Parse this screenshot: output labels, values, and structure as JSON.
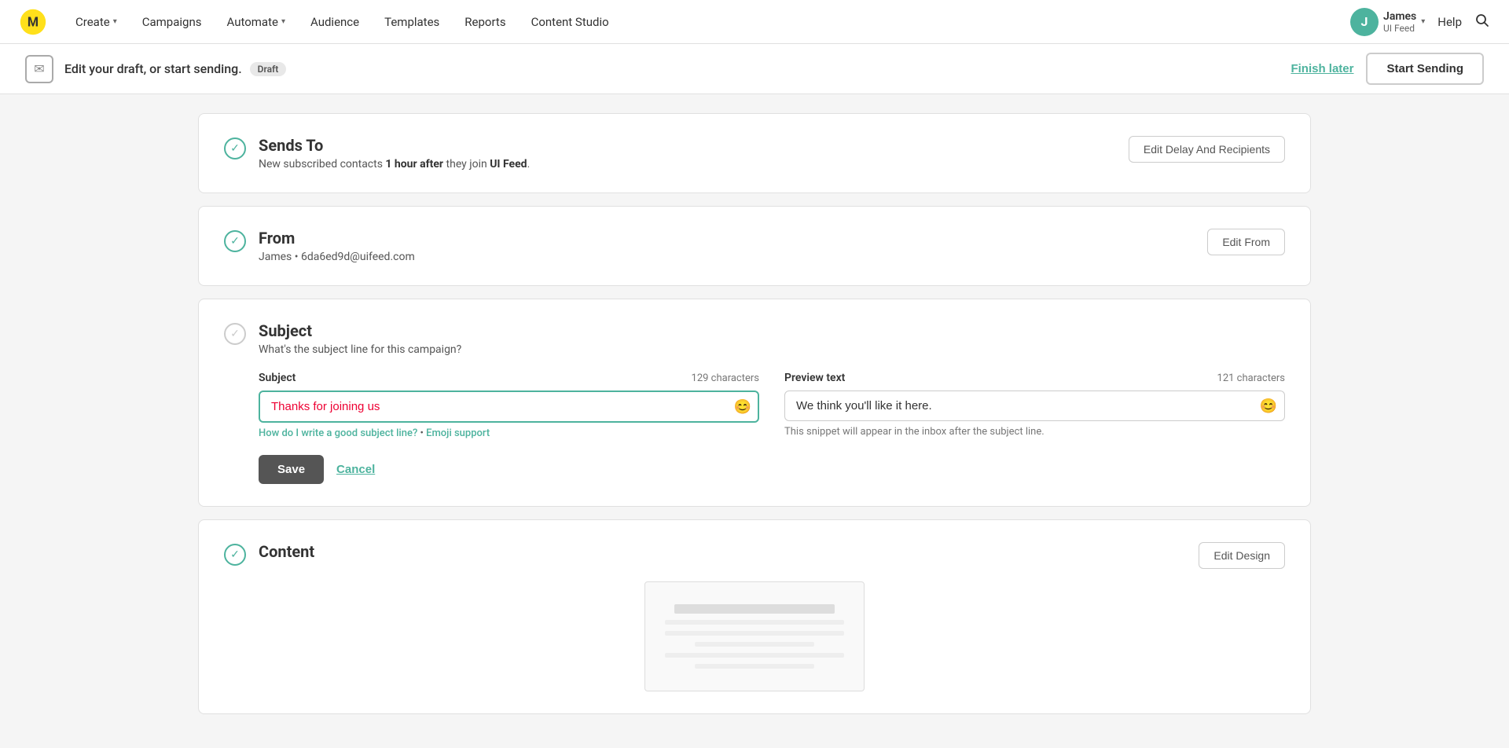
{
  "nav": {
    "logo_alt": "Mailchimp",
    "items": [
      {
        "label": "Create",
        "has_dropdown": true
      },
      {
        "label": "Campaigns",
        "has_dropdown": false
      },
      {
        "label": "Automate",
        "has_dropdown": true
      },
      {
        "label": "Audience",
        "has_dropdown": false
      },
      {
        "label": "Templates",
        "has_dropdown": false
      },
      {
        "label": "Reports",
        "has_dropdown": false
      },
      {
        "label": "Content Studio",
        "has_dropdown": false
      }
    ],
    "user": {
      "initial": "J",
      "name": "James",
      "account": "UI Feed"
    },
    "help_label": "Help"
  },
  "top_bar": {
    "icon": "✉",
    "text": "Edit your draft, or start sending.",
    "badge": "Draft",
    "finish_later_label": "Finish later",
    "start_sending_label": "Start Sending"
  },
  "sends_to": {
    "title": "Sends To",
    "description_prefix": "New subscribed contacts ",
    "description_bold": "1 hour after",
    "description_suffix": " they join ",
    "description_bold2": "UI Feed",
    "description_end": ".",
    "edit_button": "Edit Delay And Recipients"
  },
  "from": {
    "title": "From",
    "name": "James",
    "separator": "•",
    "email": "6da6ed9d@uifeed.com",
    "edit_button": "Edit From"
  },
  "subject": {
    "title": "Subject",
    "question": "What's the subject line for this campaign?",
    "subject_label": "Subject",
    "subject_char_count": "129 characters",
    "subject_value": "Thanks for joining us",
    "emoji_icon": "😊",
    "hint_link1": "How do I write a good subject line?",
    "hint_separator": " • ",
    "hint_link2": "Emoji support",
    "preview_label": "Preview text",
    "preview_char_count": "121 characters",
    "preview_value": "We think you'll like it here.",
    "preview_placeholder": "We think you'll like it here.",
    "preview_hint": "This snippet will appear in the inbox after the subject line.",
    "save_label": "Save",
    "cancel_label": "Cancel"
  },
  "content": {
    "title": "Content",
    "edit_button": "Edit Design"
  }
}
